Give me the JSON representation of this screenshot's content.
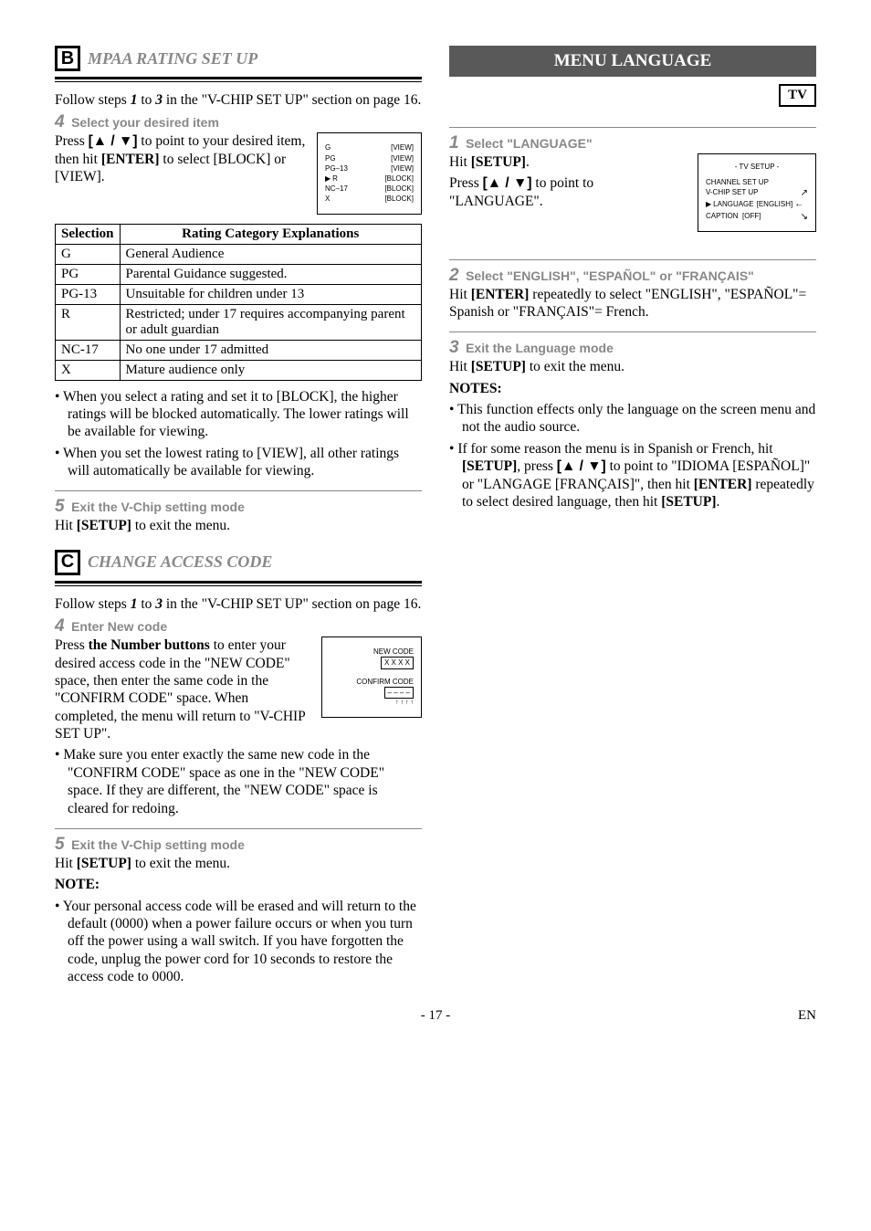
{
  "page": {
    "number": "- 17 -",
    "suffix": "EN"
  },
  "left": {
    "B": {
      "letter": "B",
      "title": "MPAA RATING SET UP",
      "intro_a": "Follow steps ",
      "intro_1": "1",
      "intro_b": " to ",
      "intro_3": "3",
      "intro_c": " in the \"V-CHIP SET UP\" section on page 16.",
      "step4_num": "4",
      "step4_label": "Select your desired item",
      "step4_a": "Press ",
      "step4_keys": "[▲ / ▼]",
      "step4_b": " to point to your desired item, then hit ",
      "step4_enter": "[ENTER]",
      "step4_c": " to select [BLOCK] or [VIEW].",
      "osd": {
        "rows": [
          {
            "l": "G",
            "r": "[VIEW]"
          },
          {
            "l": "PG",
            "r": "[VIEW]"
          },
          {
            "l": "PG–13",
            "r": "[VIEW]"
          },
          {
            "l": "R",
            "r": "[BLOCK]"
          },
          {
            "l": "NC–17",
            "r": "[BLOCK]"
          },
          {
            "l": "X",
            "r": "[BLOCK]"
          }
        ]
      },
      "table": {
        "h1": "Selection",
        "h2": "Rating Category Explanations",
        "rows": [
          {
            "s": "G",
            "e": "General Audience"
          },
          {
            "s": "PG",
            "e": "Parental Guidance suggested."
          },
          {
            "s": "PG-13",
            "e": "Unsuitable for children under 13"
          },
          {
            "s": "R",
            "e": "Restricted; under 17 requires accompanying parent or adult guardian"
          },
          {
            "s": "NC-17",
            "e": "No one under 17 admitted"
          },
          {
            "s": "X",
            "e": "Mature audience only"
          }
        ]
      },
      "bullets": [
        "When you select a rating and set it to [BLOCK], the higher ratings will be blocked automatically. The lower ratings will be available for viewing.",
        "When you set the lowest rating to [VIEW], all other ratings will automatically be available for viewing."
      ],
      "step5_num": "5",
      "step5_label": "Exit the V-Chip setting mode",
      "step5_a": "Hit ",
      "step5_setup": "[SETUP]",
      "step5_b": " to exit the menu."
    },
    "C": {
      "letter": "C",
      "title": "CHANGE ACCESS CODE",
      "intro_a": "Follow steps ",
      "intro_1": "1",
      "intro_b": " to ",
      "intro_3": "3",
      "intro_c": " in the \"V-CHIP SET UP\" section on page 16.",
      "step4_num": "4",
      "step4_label": "Enter New code",
      "step4_a": "Press ",
      "step4_nb": "the Number buttons",
      "step4_b": " to enter your desired access code in the \"NEW CODE\" space, then enter the same code in the \"CONFIRM CODE\" space. When completed, the menu will return to \"V-CHIP SET UP\".",
      "osd": {
        "new": "NEW CODE",
        "newval": "X X X X",
        "conf": "CONFIRM CODE",
        "confval": "– – – –"
      },
      "bullets": [
        "Make sure you enter exactly the same new code in the \"CONFIRM CODE\" space as one in the \"NEW CODE\" space. If they are different, the \"NEW CODE\" space is cleared for redoing."
      ],
      "step5_num": "5",
      "step5_label": "Exit the V-Chip setting mode",
      "step5_a": "Hit ",
      "step5_setup": "[SETUP]",
      "step5_b": " to exit the menu.",
      "note_label": "NOTE:",
      "note_bullet": "Your personal access code will be erased and will return to the default (0000) when a power failure occurs or when you turn off the power using a wall switch. If you have forgotten the code, unplug the power cord for 10 seconds to restore the access code to 0000."
    }
  },
  "right": {
    "title": "MENU LANGUAGE",
    "tv": "TV",
    "step1_num": "1",
    "step1_label": "Select \"LANGUAGE\"",
    "step1_a": "Hit ",
    "step1_setup": "[SETUP]",
    "step1_b": ".",
    "step1_c": "Press ",
    "step1_keys": "[▲ / ▼]",
    "step1_d": " to point to \"LANGUAGE\".",
    "osd": {
      "title": "- TV SETUP -",
      "r1": "CHANNEL SET UP",
      "r2": "V-CHIP SET UP",
      "r3a": "LANGUAGE",
      "r3b": "[ENGLISH]",
      "r4a": "CAPTION",
      "r4b": "[OFF]"
    },
    "step2_num": "2",
    "step2_label": "Select \"ENGLISH\", \"ESPAÑOL\" or \"FRANÇAIS\"",
    "step2_a": "Hit ",
    "step2_enter": "[ENTER]",
    "step2_b": " repeatedly to select \"ENGLISH\", \"ESPAÑOL\"= Spanish or \"FRANÇAIS\"= French.",
    "step3_num": "3",
    "step3_label": "Exit the Language mode",
    "step3_a": "Hit ",
    "step3_setup": "[SETUP]",
    "step3_b": " to exit the menu.",
    "notes_label": "NOTES:",
    "notes": [
      "This function effects only the language on the screen menu and not the audio source."
    ],
    "note2_a": "If for some reason the menu is in Spanish or French, hit ",
    "note2_setup": "[SETUP]",
    "note2_b": ", press ",
    "note2_keys": "[▲ / ▼]",
    "note2_c": " to point to \"IDIOMA [ESPAÑOL]\" or \"LANGAGE [FRANÇAIS]\", then hit ",
    "note2_enter": "[ENTER]",
    "note2_d": " repeatedly to select desired language, then hit ",
    "note2_setup2": "[SETUP]",
    "note2_e": "."
  }
}
